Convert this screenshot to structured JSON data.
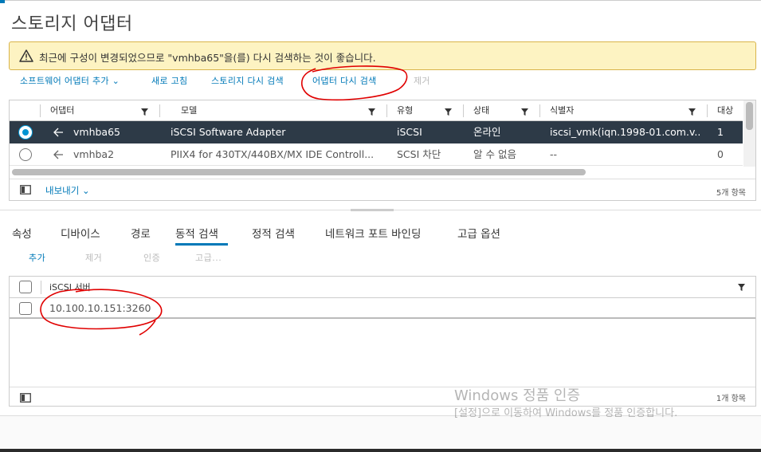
{
  "page": {
    "title": "스토리지 어댑터"
  },
  "alert": {
    "text": "최근에 구성이 변경되었으므로 \"vmhba65\"을(를) 다시 검색하는 것이 좋습니다."
  },
  "toolbar": {
    "add_software_adapter": "소프트웨어 어댑터 추가",
    "refresh": "새로 고침",
    "rescan_storage": "스토리지 다시 검색",
    "rescan_adapter": "어댑터 다시 검색",
    "remove": "제거"
  },
  "adapters_table": {
    "columns": [
      "어댑터",
      "모델",
      "유형",
      "상태",
      "식별자",
      "대상"
    ],
    "rows": [
      {
        "adapter": "vmhba65",
        "model": "iSCSI Software Adapter",
        "type": "iSCSI",
        "status": "온라인",
        "identifier": "iscsi_vmk(iqn.1998-01.com.v...",
        "targets": "1",
        "selected": true
      },
      {
        "adapter": "vmhba2",
        "model": "PIIX4 for 430TX/440BX/MX IDE Controll...",
        "type": "SCSI 차단",
        "status": "알 수 없음",
        "identifier": "--",
        "targets": "0",
        "selected": false
      }
    ],
    "export_label": "내보내기",
    "item_count": "5개 항목"
  },
  "tabs": [
    "속성",
    "디바이스",
    "경로",
    "동적 검색",
    "정적 검색",
    "네트워크 포트 바인딩",
    "고급 옵션"
  ],
  "active_tab": "동적 검색",
  "discovery_toolbar": {
    "add": "추가",
    "remove": "제거",
    "auth": "인증",
    "advanced": "고급..."
  },
  "servers_table": {
    "column": "iSCSI 서버",
    "rows": [
      "10.100.10.151:3260"
    ],
    "item_count": "1개 항목"
  },
  "watermark": {
    "line1": "Windows 정품 인증",
    "line2": "[설정]으로 이동하여 Windows를 정품 인증합니다."
  },
  "colors": {
    "accent": "#0079b8",
    "selected_row": "#2d3a47",
    "warning_bg": "#fdf3c2",
    "annotation": "#e00000"
  }
}
